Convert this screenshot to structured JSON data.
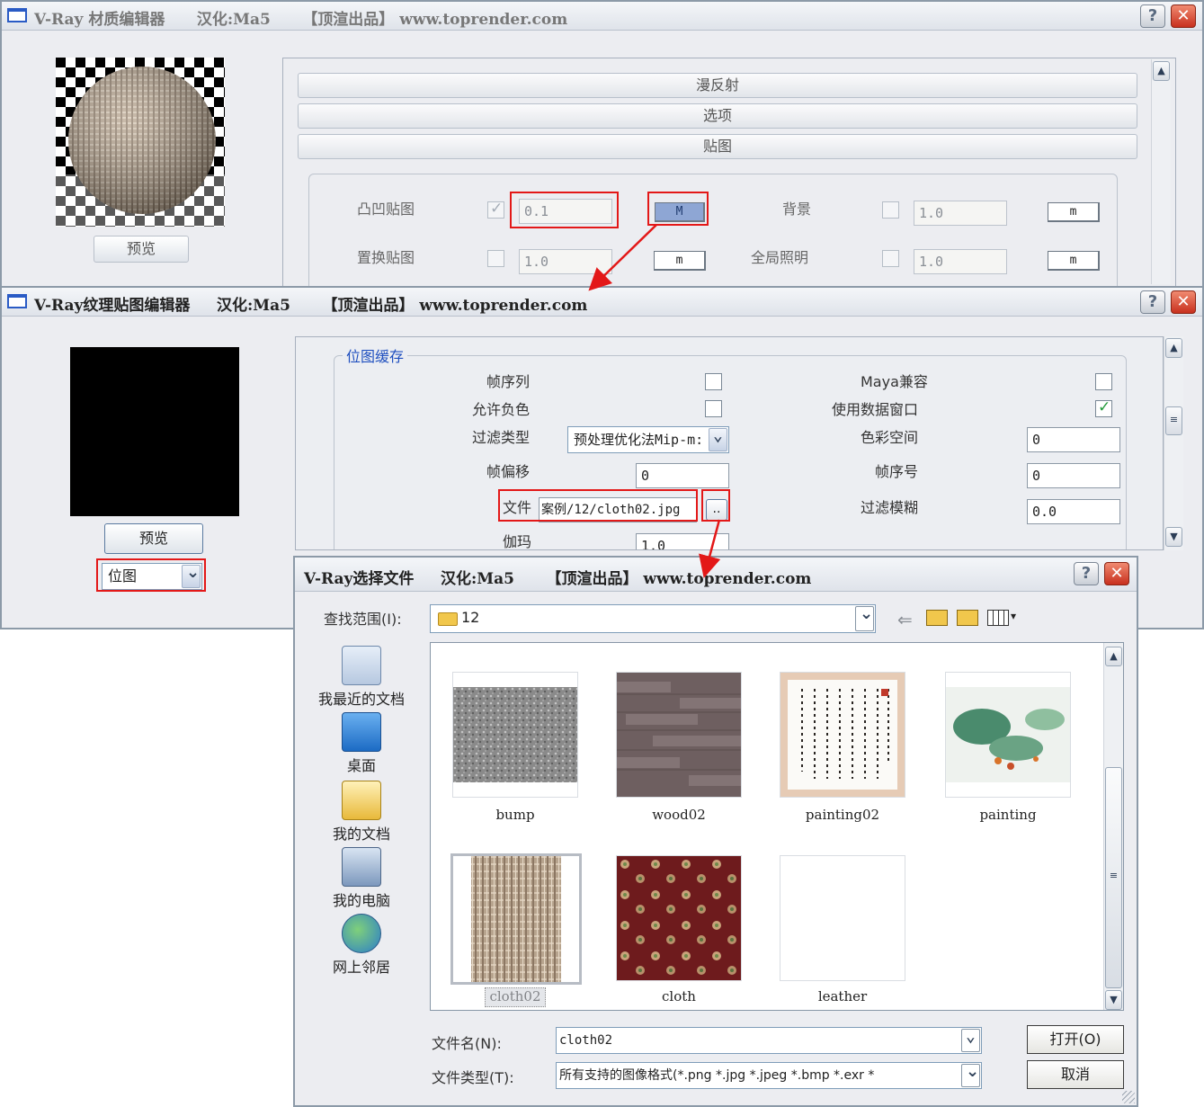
{
  "material_editor": {
    "title": "V-Ray 材质编辑器      汉化:Ma5      【顶渲出品】 www.toprender.com",
    "preview_button": "预览",
    "rollouts": [
      "漫反射",
      "选项",
      "贴图"
    ],
    "maps": {
      "bump": {
        "label": "凸凹贴图",
        "checked": true,
        "value": "0.1",
        "button": "M"
      },
      "background": {
        "label": "背景",
        "checked": false,
        "value": "1.0",
        "button": "m"
      },
      "displacement": {
        "label": "置换贴图",
        "checked": false,
        "value": "1.0",
        "button": "m"
      },
      "gi": {
        "label": "全局照明",
        "checked": false,
        "value": "1.0",
        "button": "m"
      }
    }
  },
  "texture_editor": {
    "title": "V-Ray纹理贴图编辑器     汉化:Ma5      【顶渲出品】 www.toprender.com",
    "preview_button": "预览",
    "type_select": "位图",
    "group_title": "位图缓存",
    "fields": {
      "frame_sequence": {
        "label": "帧序列",
        "checked": false
      },
      "allow_negative": {
        "label": "允许负色",
        "checked": false
      },
      "filter_type": {
        "label": "过滤类型",
        "value": "预处理优化法Mip-m:"
      },
      "frame_offset": {
        "label": "帧偏移",
        "value": "0"
      },
      "file": {
        "label": "文件",
        "value": "案例/12/cloth02.jpg",
        "browse": ".."
      },
      "gamma": {
        "label": "伽玛",
        "value": "1.0"
      },
      "maya_compat": {
        "label": "Maya兼容",
        "checked": false
      },
      "use_data_window": {
        "label": "使用数据窗口",
        "checked": true
      },
      "color_space": {
        "label": "色彩空间",
        "value": "0"
      },
      "frame_number": {
        "label": "帧序号",
        "value": "0"
      },
      "filter_blur": {
        "label": "过滤模糊",
        "value": "0.0"
      }
    }
  },
  "file_dialog": {
    "title": "V-Ray选择文件     汉化:Ma5      【顶渲出品】 www.toprender.com",
    "look_in_label": "查找范围(I):",
    "look_in_value": "12",
    "places": [
      "我最近的文档",
      "桌面",
      "我的文档",
      "我的电脑",
      "网上邻居"
    ],
    "files": [
      {
        "name": "bump",
        "selected": false
      },
      {
        "name": "wood02",
        "selected": false
      },
      {
        "name": "painting02",
        "selected": false
      },
      {
        "name": "painting",
        "selected": false
      },
      {
        "name": "cloth02",
        "selected": true
      },
      {
        "name": "cloth",
        "selected": false
      },
      {
        "name": "leather",
        "selected": false
      }
    ],
    "filename_label": "文件名(N):",
    "filename_value": "cloth02",
    "filetype_label": "文件类型(T):",
    "filetype_value": "所有支持的图像格式(*.png *.jpg *.jpeg *.bmp *.exr *",
    "open_button": "打开(O)",
    "cancel_button": "取消"
  },
  "colors": {
    "highlight": "#e31818",
    "title_text": "#333333",
    "link_blue": "#1f4fbf"
  }
}
